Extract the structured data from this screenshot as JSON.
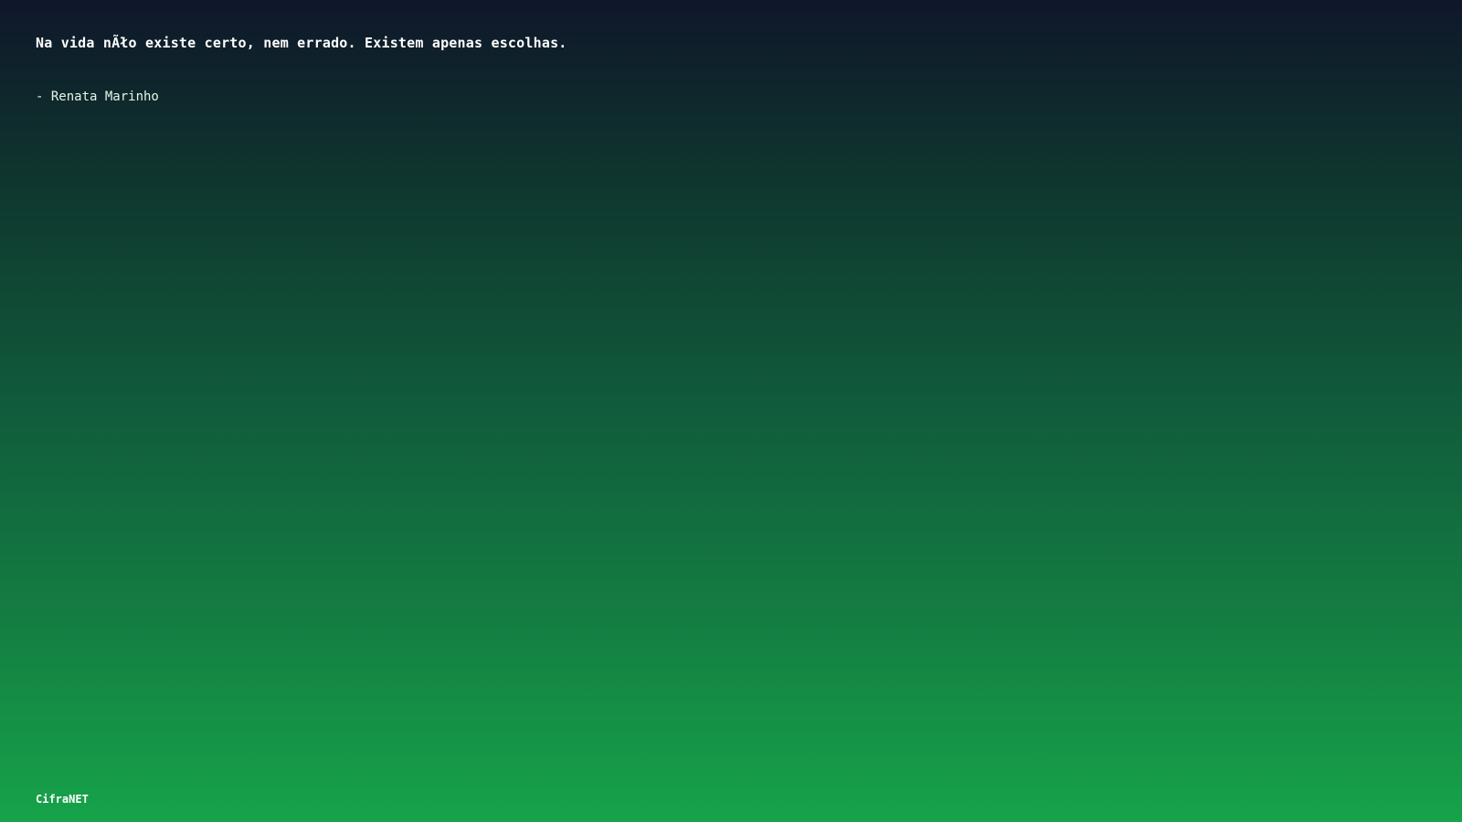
{
  "quote": {
    "text": "Na vida nÃło existe certo, nem errado. Existem apenas escolhas.",
    "author": "- Renata Marinho"
  },
  "brand": {
    "label": "CifraNET"
  },
  "colors": {
    "gradient_top": "#0f172a",
    "gradient_bottom": "#16a34a",
    "text": "#ffffff"
  }
}
